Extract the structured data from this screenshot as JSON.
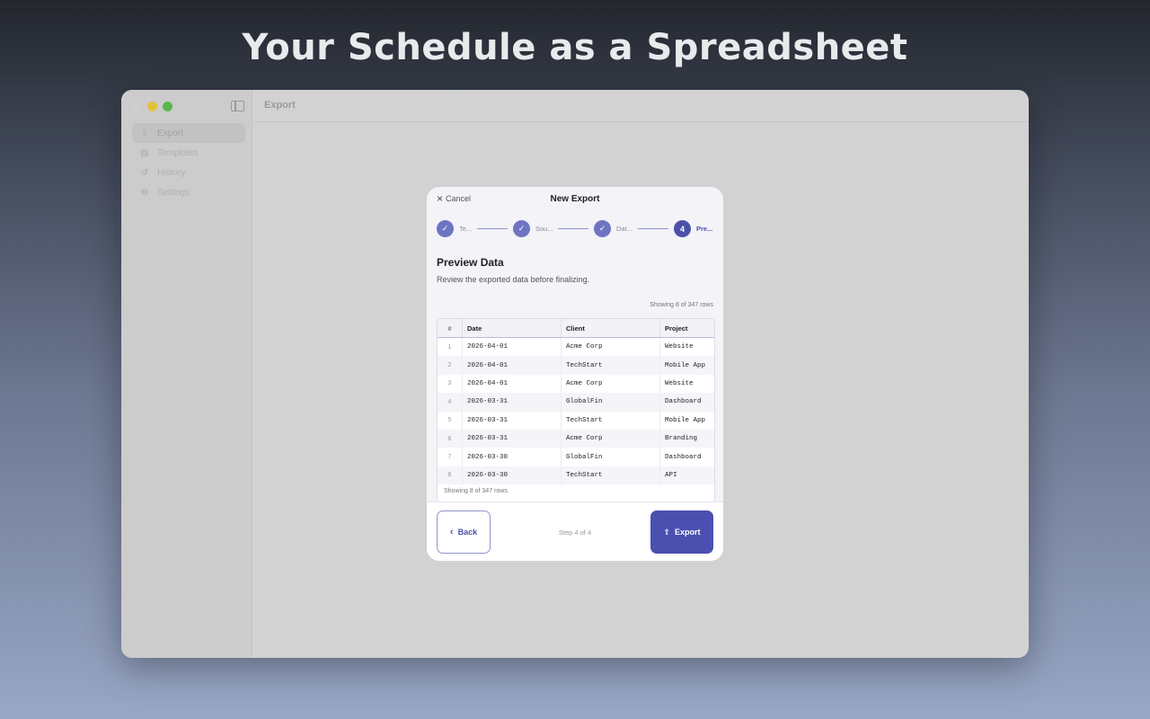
{
  "headline": "Your Schedule as a Spreadsheet",
  "window": {
    "title": "Export",
    "sidebar": {
      "items": [
        {
          "label": "Export",
          "icon": "export-icon",
          "active": true
        },
        {
          "label": "Templates",
          "icon": "document-icon",
          "active": false
        },
        {
          "label": "History",
          "icon": "history-icon",
          "active": false
        },
        {
          "label": "Settings",
          "icon": "gear-icon",
          "active": false
        }
      ]
    }
  },
  "modal": {
    "cancel_label": "Cancel",
    "title": "New Export",
    "steps": [
      {
        "label": "Te...",
        "state": "done"
      },
      {
        "label": "Sou...",
        "state": "done"
      },
      {
        "label": "Dat...",
        "state": "done"
      },
      {
        "label": "Pre...",
        "number": "4",
        "state": "current"
      }
    ],
    "section_title": "Preview Data",
    "section_subtitle": "Review the exported data before finalizing.",
    "showing_top": "Showing 8 of 347 rows",
    "table": {
      "headers": [
        "#",
        "Date",
        "Client",
        "Project"
      ],
      "rows": [
        [
          "1",
          "2026-04-01",
          "Acme Corp",
          "Website"
        ],
        [
          "2",
          "2026-04-01",
          "TechStart",
          "Mobile App"
        ],
        [
          "3",
          "2026-04-01",
          "Acme Corp",
          "Website"
        ],
        [
          "4",
          "2026-03-31",
          "GlobalFin",
          "Dashboard"
        ],
        [
          "5",
          "2026-03-31",
          "TechStart",
          "Mobile App"
        ],
        [
          "6",
          "2026-03-31",
          "Acme Corp",
          "Branding"
        ],
        [
          "7",
          "2026-03-30",
          "GlobalFin",
          "Dashboard"
        ],
        [
          "8",
          "2026-03-30",
          "TechStart",
          "API"
        ]
      ]
    },
    "showing_bottom": "Showing 8 of 347 rows",
    "footer": {
      "back_label": "Back",
      "step_indicator": "Step 4 of 4",
      "export_label": "Export"
    }
  },
  "colors": {
    "accent": "#4b50b0",
    "step_done": "#6e74c2"
  }
}
